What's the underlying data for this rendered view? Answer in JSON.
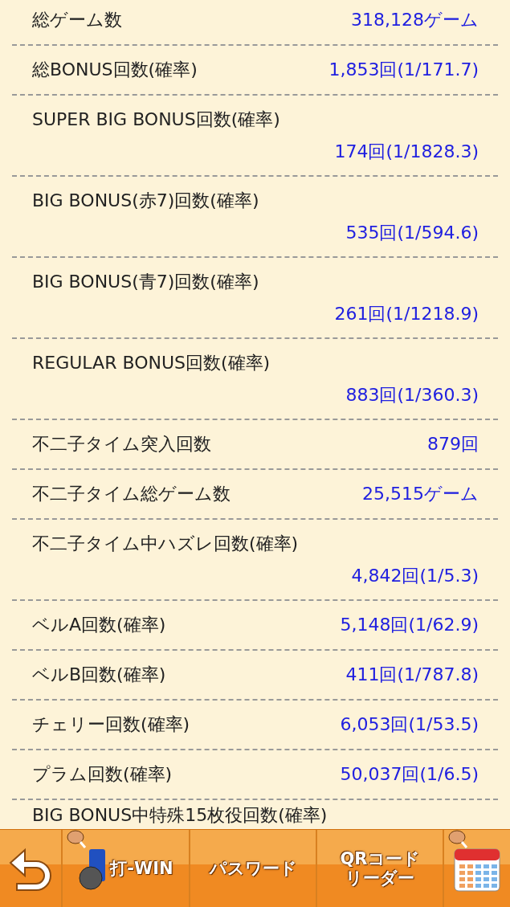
{
  "stats": [
    {
      "kind": "inline",
      "label": "総ゲーム数",
      "value": "318,128ゲーム"
    },
    {
      "kind": "inline",
      "label": "総BONUS回数(確率)",
      "value": "1,853回(1/171.7)"
    },
    {
      "kind": "stacked",
      "label": "SUPER BIG BONUS回数(確率)",
      "value": "174回(1/1828.3)"
    },
    {
      "kind": "stacked",
      "label": "BIG BONUS(赤7)回数(確率)",
      "value": "535回(1/594.6)"
    },
    {
      "kind": "stacked",
      "label": "BIG BONUS(青7)回数(確率)",
      "value": "261回(1/1218.9)"
    },
    {
      "kind": "stacked",
      "label": "REGULAR BONUS回数(確率)",
      "value": "883回(1/360.3)"
    },
    {
      "kind": "inline",
      "label": "不二子タイム突入回数",
      "value": "879回"
    },
    {
      "kind": "inline",
      "label": "不二子タイム総ゲーム数",
      "value": "25,515ゲーム"
    },
    {
      "kind": "stacked",
      "label": "不二子タイム中ハズレ回数(確率)",
      "value": "4,842回(1/5.3)"
    },
    {
      "kind": "inline",
      "label": "ベルA回数(確率)",
      "value": "5,148回(1/62.9)"
    },
    {
      "kind": "inline",
      "label": "ベルB回数(確率)",
      "value": "411回(1/787.8)"
    },
    {
      "kind": "inline",
      "label": "チェリー回数(確率)",
      "value": "6,053回(1/53.5)"
    },
    {
      "kind": "inline",
      "label": "プラム回数(確率)",
      "value": "50,037回(1/6.5)"
    },
    {
      "kind": "cut",
      "label": "BIG BONUS中特殊15枚役回数(確率)"
    }
  ],
  "toolbar": [
    {
      "kind": "back"
    },
    {
      "kind": "logo",
      "label": "打-WIN",
      "badge": true
    },
    {
      "kind": "text",
      "label": "パスワード",
      "badge": false
    },
    {
      "kind": "lines",
      "lines": [
        "QRコード",
        "リーダー"
      ],
      "badge": false
    },
    {
      "kind": "calendar",
      "badge": true
    }
  ]
}
